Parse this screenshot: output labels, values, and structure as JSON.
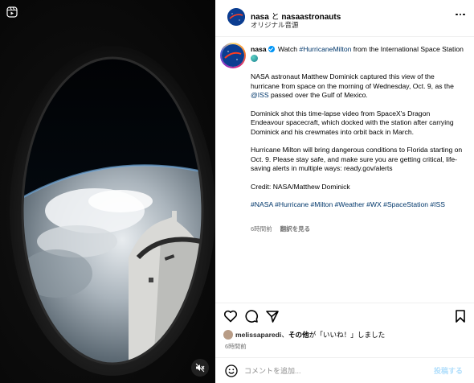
{
  "header": {
    "author1": "nasa",
    "conj": "と",
    "author2": "nasaastronauts",
    "audio": "オリジナル音源"
  },
  "caption": {
    "username": "nasa",
    "intro": "Watch",
    "intro_tag": "#HurricaneMilton",
    "intro_rest": "from the International Space Station",
    "p1a": "NASA astronaut Matthew Dominick captured this view of the hurricane from space on the morning of Wednesday, Oct. 9, as the",
    "p1_tag": "@ISS",
    "p1b": "passed over the Gulf of Mexico.",
    "p2": "Dominick shot this time-lapse video from SpaceX's Dragon Endeavour spacecraft, which docked with the station after carrying Dominick and his crewmates into orbit back in March.",
    "p3": "Hurricane Milton will bring dangerous conditions to Florida starting on Oct. 9. Please stay safe, and make sure you are getting critical, life-saving alerts in multiple ways: ready.gov/alerts",
    "p4": "Credit: NASA/Matthew Dominick",
    "hashtags": "#NASA #Hurricane #Milton #Weather #WX #SpaceStation #ISS",
    "time": "6時間前",
    "translate": "翻訳を見る"
  },
  "likes": {
    "user": "melissaparedi",
    "sep": "、",
    "others": "その他",
    "suffix": "が「いいね！」しました"
  },
  "post_time": "6時間前",
  "comment": {
    "placeholder": "コメントを追加...",
    "post_label": "投稿する"
  },
  "icons": {
    "header_more": "more-icon",
    "like": "heart-icon",
    "comment": "comment-icon",
    "share": "share-icon",
    "save": "bookmark-icon",
    "emoji": "emoji-icon",
    "mute": "mute-icon",
    "reels": "reels-icon"
  },
  "colors": {
    "link": "#00376b",
    "verified": "#0095f6",
    "post_button_disabled": "#b2dffc"
  }
}
